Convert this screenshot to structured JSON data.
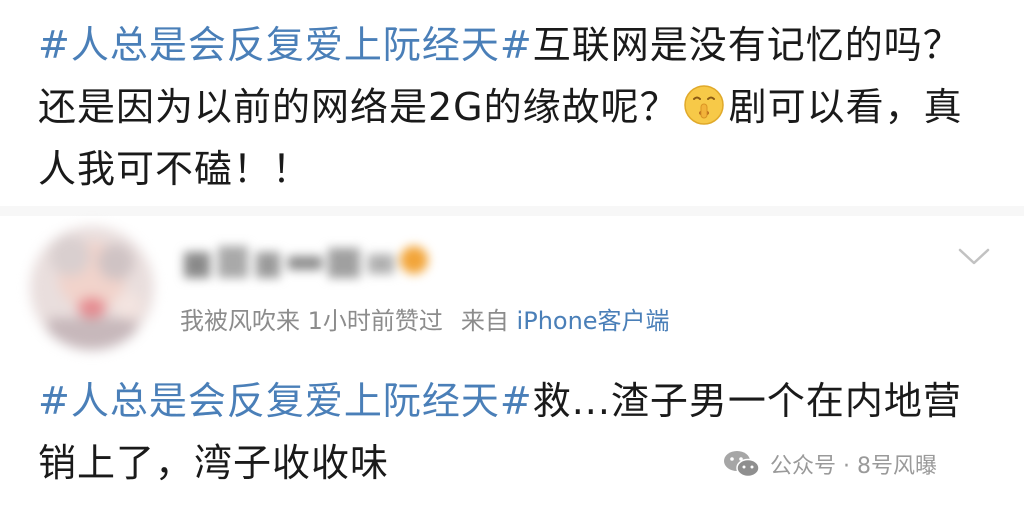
{
  "post_top": {
    "hashtag": "#人总是会反复爱上阮经天#",
    "text_a": "互联网是没有记忆的吗？还是因为以前的网络是2G的缘故呢？",
    "emoji": "shushing-face-emoji",
    "text_b": "剧可以看，真人我可不磕！！"
  },
  "repost": {
    "avatar": "blurred-avatar",
    "username": "blurred-username",
    "meta_activity": "我被风吹来 1小时前赞过",
    "meta_source_prefix": "来自",
    "meta_source_client": "iPhone客户端",
    "menu_icon": "chevron-down-icon"
  },
  "post_bottom": {
    "hashtag": "#人总是会反复爱上阮经天#",
    "text": "救...渣子男一个在内地营销上了，湾子收收味"
  },
  "watermark": {
    "icon": "wechat-icon",
    "text": "公众号 · 8号风曝"
  },
  "colors": {
    "hashtag": "#4a7fb8",
    "body_text": "#1a1a1a",
    "meta_text": "#8c8c8c",
    "client_link": "#4a7fb8"
  }
}
